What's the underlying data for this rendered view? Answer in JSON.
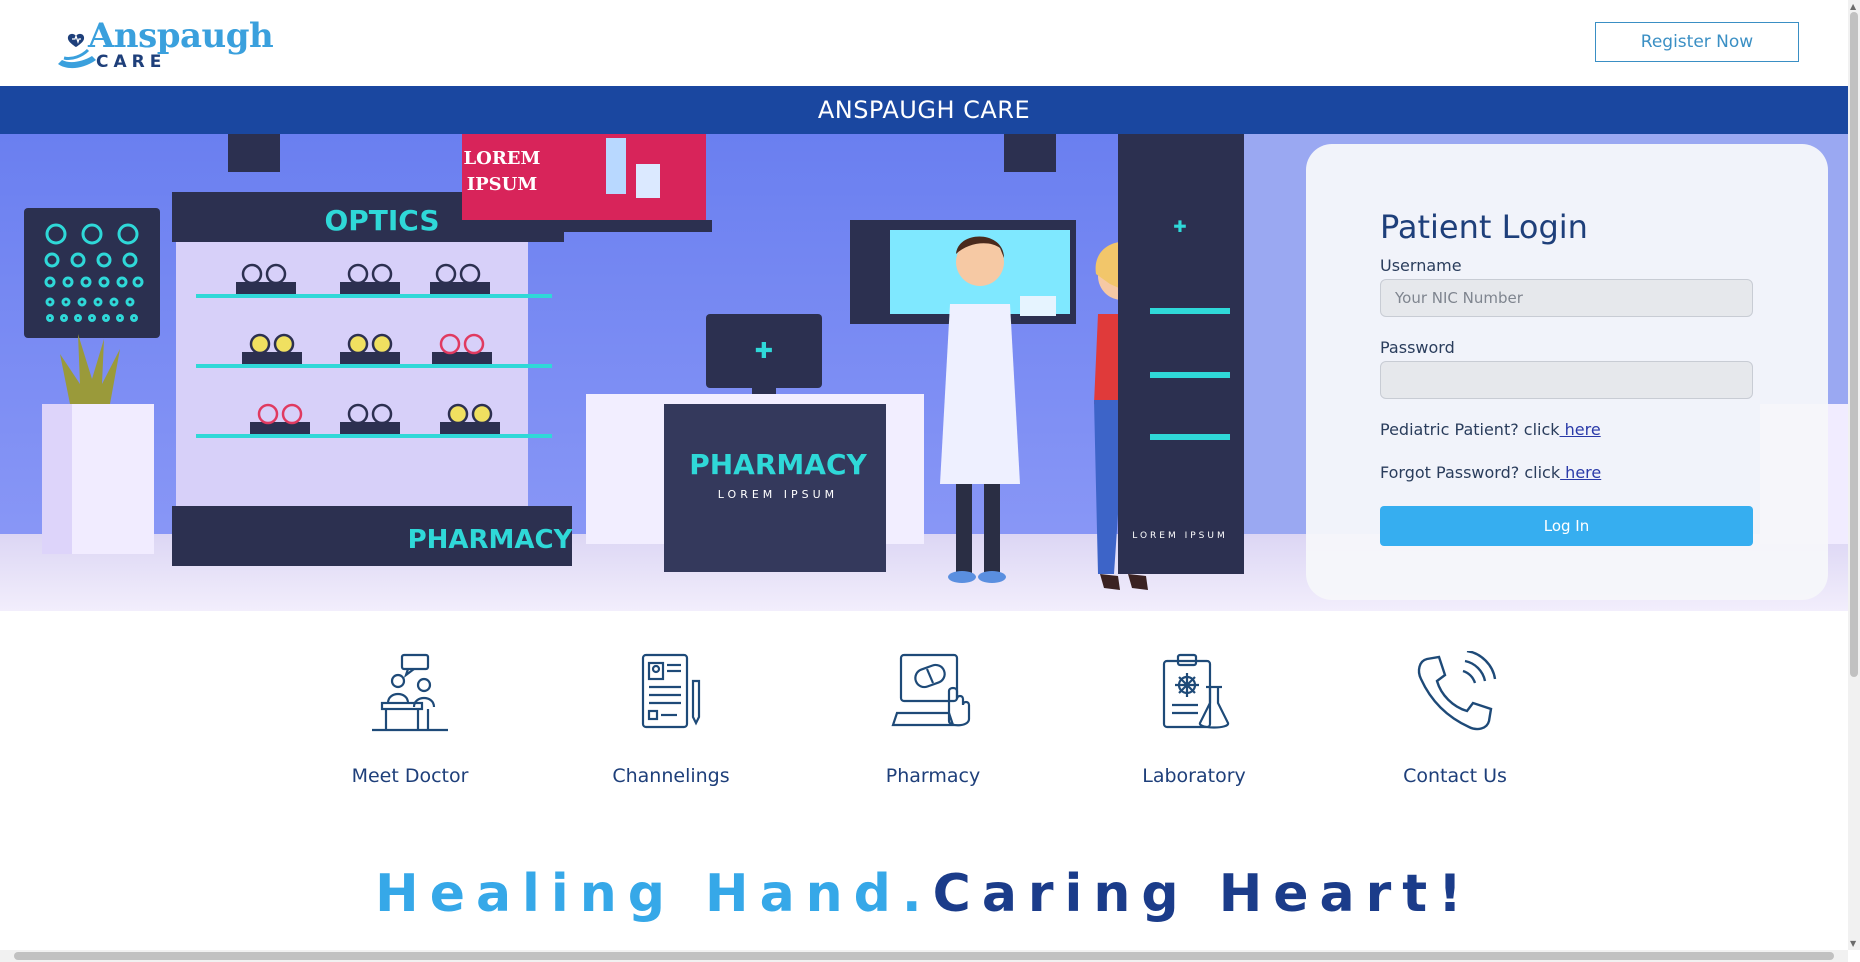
{
  "header": {
    "logo_word": "Anspaugh",
    "logo_sub": "CARE",
    "register_label": "Register Now"
  },
  "title_band": {
    "text": "ANSPAUGH CARE"
  },
  "hero": {
    "optics_sign": "OPTICS",
    "pharmacy_sign": "PHARMACY",
    "counter_sign": "PHARMACY",
    "counter_sub": "LOREM IPSUM",
    "poster_text_1": "LOREM",
    "poster_text_2": "IPSUM",
    "tower_text": "LOREM IPSUM"
  },
  "login": {
    "title": "Patient Login",
    "username_label": "Username",
    "username_placeholder": "Your NIC Number",
    "username_value": "",
    "password_label": "Password",
    "password_value": "",
    "pediatric_text": "Pediatric Patient? click",
    "pediatric_link": " here",
    "forgot_text": "Forgot Password? click",
    "forgot_link": " here",
    "login_button": "Log In"
  },
  "services": [
    {
      "label": "Meet Doctor",
      "icon": "meet-doctor-icon"
    },
    {
      "label": "Channelings",
      "icon": "channelings-icon"
    },
    {
      "label": "Pharmacy",
      "icon": "pharmacy-icon"
    },
    {
      "label": "Laboratory",
      "icon": "laboratory-icon"
    },
    {
      "label": "Contact Us",
      "icon": "contact-phone-icon"
    }
  ],
  "tagline": {
    "part1": "Healing Hand.",
    "part2": "Caring Heart!"
  },
  "colors": {
    "brand_blue": "#1a47a0",
    "accent_light_blue": "#36aef0",
    "text_navy": "#1e3f7a"
  }
}
